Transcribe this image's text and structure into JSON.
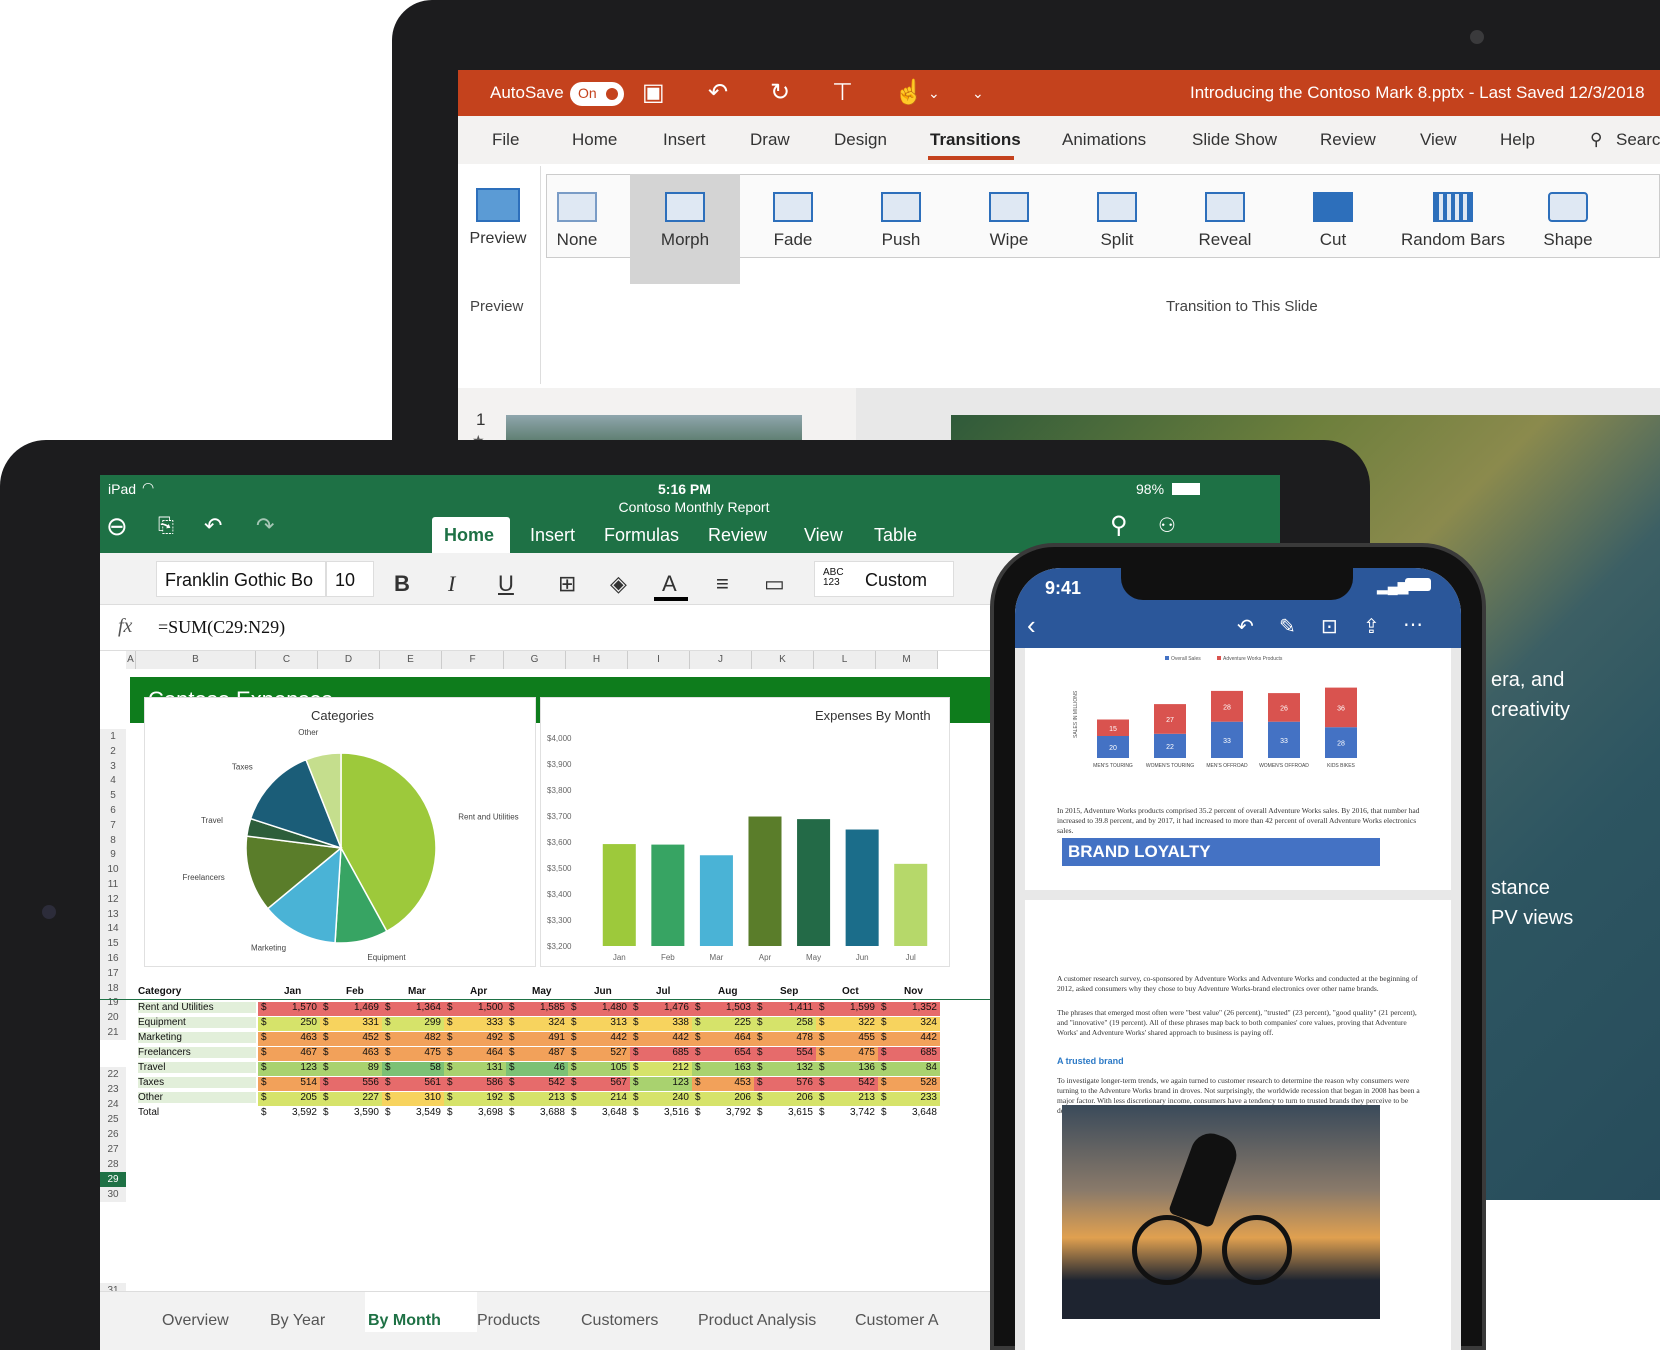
{
  "powerpoint": {
    "autosave_label": "AutoSave",
    "autosave_state": "On",
    "file_title": "Introducing the Contoso Mark 8.pptx  -  Last Saved  12/3/2018",
    "tabs": [
      "File",
      "Home",
      "Insert",
      "Draw",
      "Design",
      "Transitions",
      "Animations",
      "Slide Show",
      "Review",
      "View",
      "Help"
    ],
    "active_tab": "Transitions",
    "search_label": "Search",
    "preview_label": "Preview",
    "preview_group_label": "Preview",
    "transitions": [
      "None",
      "Morph",
      "Fade",
      "Push",
      "Wipe",
      "Split",
      "Reveal",
      "Cut",
      "Random Bars",
      "Shape"
    ],
    "selected_transition": "Morph",
    "transition_group_label": "Transition to This Slide",
    "slide_number": "1",
    "slide_star": "★",
    "slide_text_1": "era, and",
    "slide_text_2": "creativity",
    "slide_text_3": "stance",
    "slide_text_4": "PV views",
    "accent": "#c4421d"
  },
  "excel": {
    "status_left": "iPad",
    "time": "5:16 PM",
    "doc_title": "Contoso Monthly Report",
    "battery": "98%",
    "tabs": [
      "Home",
      "Insert",
      "Formulas",
      "Review",
      "View",
      "Table"
    ],
    "active_tab": "Home",
    "font_name": "Franklin Gothic Bo",
    "font_size": "10",
    "bold": "B",
    "italic": "I",
    "underline": "U",
    "font_color": "A",
    "number_icon_label": "ABC 123",
    "number_format": "Custom",
    "fx": "fx",
    "formula": "=SUM(C29:N29)",
    "columns": [
      "A",
      "B",
      "C",
      "D",
      "E",
      "F",
      "G",
      "H",
      "I",
      "J",
      "K",
      "L",
      "M"
    ],
    "banner_title": "Contoso Expenses",
    "sheets": [
      "Overview",
      "By Year",
      "By Month",
      "Products",
      "Customers",
      "Product Analysis",
      "Customer A"
    ],
    "active_sheet": "By Month",
    "table_header": [
      "Category",
      "Jan",
      "Feb",
      "Mar",
      "Apr",
      "May",
      "Jun",
      "Jul",
      "Aug",
      "Sep",
      "Oct",
      "Nov"
    ],
    "table_rows": [
      {
        "row": "23",
        "cat": "Rent and Utilities",
        "vals": [
          "1,570",
          "1,469",
          "1,364",
          "1,500",
          "1,585",
          "1,480",
          "1,476",
          "1,503",
          "1,411",
          "1,599",
          "1,352"
        ]
      },
      {
        "row": "24",
        "cat": "Equipment",
        "vals": [
          "250",
          "331",
          "299",
          "333",
          "324",
          "313",
          "338",
          "225",
          "258",
          "322",
          "324"
        ]
      },
      {
        "row": "25",
        "cat": "Marketing",
        "vals": [
          "463",
          "452",
          "482",
          "492",
          "491",
          "442",
          "442",
          "464",
          "478",
          "455",
          "442"
        ]
      },
      {
        "row": "26",
        "cat": "Freelancers",
        "vals": [
          "467",
          "463",
          "475",
          "464",
          "487",
          "527",
          "685",
          "654",
          "554",
          "475",
          "685"
        ]
      },
      {
        "row": "27",
        "cat": "Travel",
        "vals": [
          "123",
          "89",
          "58",
          "131",
          "46",
          "105",
          "212",
          "163",
          "132",
          "136",
          "84"
        ]
      },
      {
        "row": "28",
        "cat": "Taxes",
        "vals": [
          "514",
          "556",
          "561",
          "586",
          "542",
          "567",
          "123",
          "453",
          "576",
          "542",
          "528"
        ]
      },
      {
        "row": "29",
        "cat": "Other",
        "vals": [
          "205",
          "227",
          "310",
          "192",
          "213",
          "214",
          "240",
          "206",
          "206",
          "213",
          "233"
        ]
      },
      {
        "row": "30",
        "cat": "Total",
        "vals": [
          "3,592",
          "3,590",
          "3,549",
          "3,698",
          "3,688",
          "3,648",
          "3,516",
          "3,792",
          "3,615",
          "3,742",
          "3,648"
        ]
      }
    ],
    "currency": "$",
    "accent": "#1e7145"
  },
  "chart_data": [
    {
      "type": "pie",
      "title": "Categories",
      "labels": [
        "Rent and Utilities",
        "Equipment",
        "Marketing",
        "Freelancers",
        "Travel",
        "Taxes",
        "Other"
      ],
      "values": [
        42,
        9,
        13,
        13,
        3,
        14,
        6
      ],
      "colors": [
        "#9dc93b",
        "#37a463",
        "#4ab3d6",
        "#5a7d2a",
        "#2d5e3a",
        "#1b5d78",
        "#c5de8d"
      ]
    },
    {
      "type": "bar",
      "title": "Expenses By Month",
      "categories": [
        "Jan",
        "Feb",
        "Mar",
        "Apr",
        "May",
        "Jun",
        "Jul"
      ],
      "values": [
        3592,
        3590,
        3549,
        3698,
        3688,
        3648,
        3516
      ],
      "colors": [
        "#9dc93b",
        "#37a463",
        "#4ab3d6",
        "#5a7d2a",
        "#236a47",
        "#1b6d8a",
        "#b6d86a"
      ],
      "ylim": [
        3200,
        4000
      ],
      "yticks": [
        "$4,000",
        "$3,900",
        "$3,800",
        "$3,700",
        "$3,600",
        "$3,500",
        "$3,400",
        "$3,300",
        "$3,200"
      ]
    },
    {
      "type": "bar",
      "title": "",
      "legend": [
        "Overall Sales",
        "Adventure Works Products"
      ],
      "ylabel": "SALES IN MILLIONS",
      "categories": [
        "MEN'S TOURING",
        "WOMEN'S TOURING",
        "MEN'S OFFROAD",
        "WOMEN'S OFFROAD",
        "KIDS BIKES"
      ],
      "series": [
        {
          "name": "Overall Sales",
          "values": [
            20,
            22,
            33,
            33,
            28
          ]
        },
        {
          "name": "Adventure Works Products",
          "values": [
            15,
            27,
            28,
            26,
            36
          ]
        }
      ]
    }
  ],
  "word": {
    "time": "9:41",
    "para1": "In 2015, Adventure Works products comprised 35.2 percent of overall Adventure Works sales. By 2016, that number had increased to 39.8 percent, and by 2017, it had increased to more than 42 percent of overall Adventure Works electronics sales.",
    "heading": "BRAND LOYALTY",
    "para2": "A customer research survey, co-sponsored by Adventure Works and Adventure Works and conducted at the beginning of 2012, asked consumers why they chose to buy Adventure Works-brand electronics over other name brands.",
    "para3": "The phrases that emerged most often were \"best value\" (26 percent), \"trusted\" (23 percent), \"good quality\" (21 percent), and \"innovative\" (19 percent). All of these phrases map back to both companies' core values, proving that Adventure Works' and Adventure Works' shared approach to business is paying off.",
    "subhead": "A trusted brand",
    "para4": "To investigate longer-term trends, we again turned to customer research to determine the reason why consumers were turning to the Adventure Works brand in droves. Not surprisingly, the worldwide recession that began in 2008 has been a major factor. With less discretionary income, consumers have a tendency to turn to trusted brands they perceive to be decent quality yet still a terrific value for the money.",
    "accent": "#2b579a"
  }
}
